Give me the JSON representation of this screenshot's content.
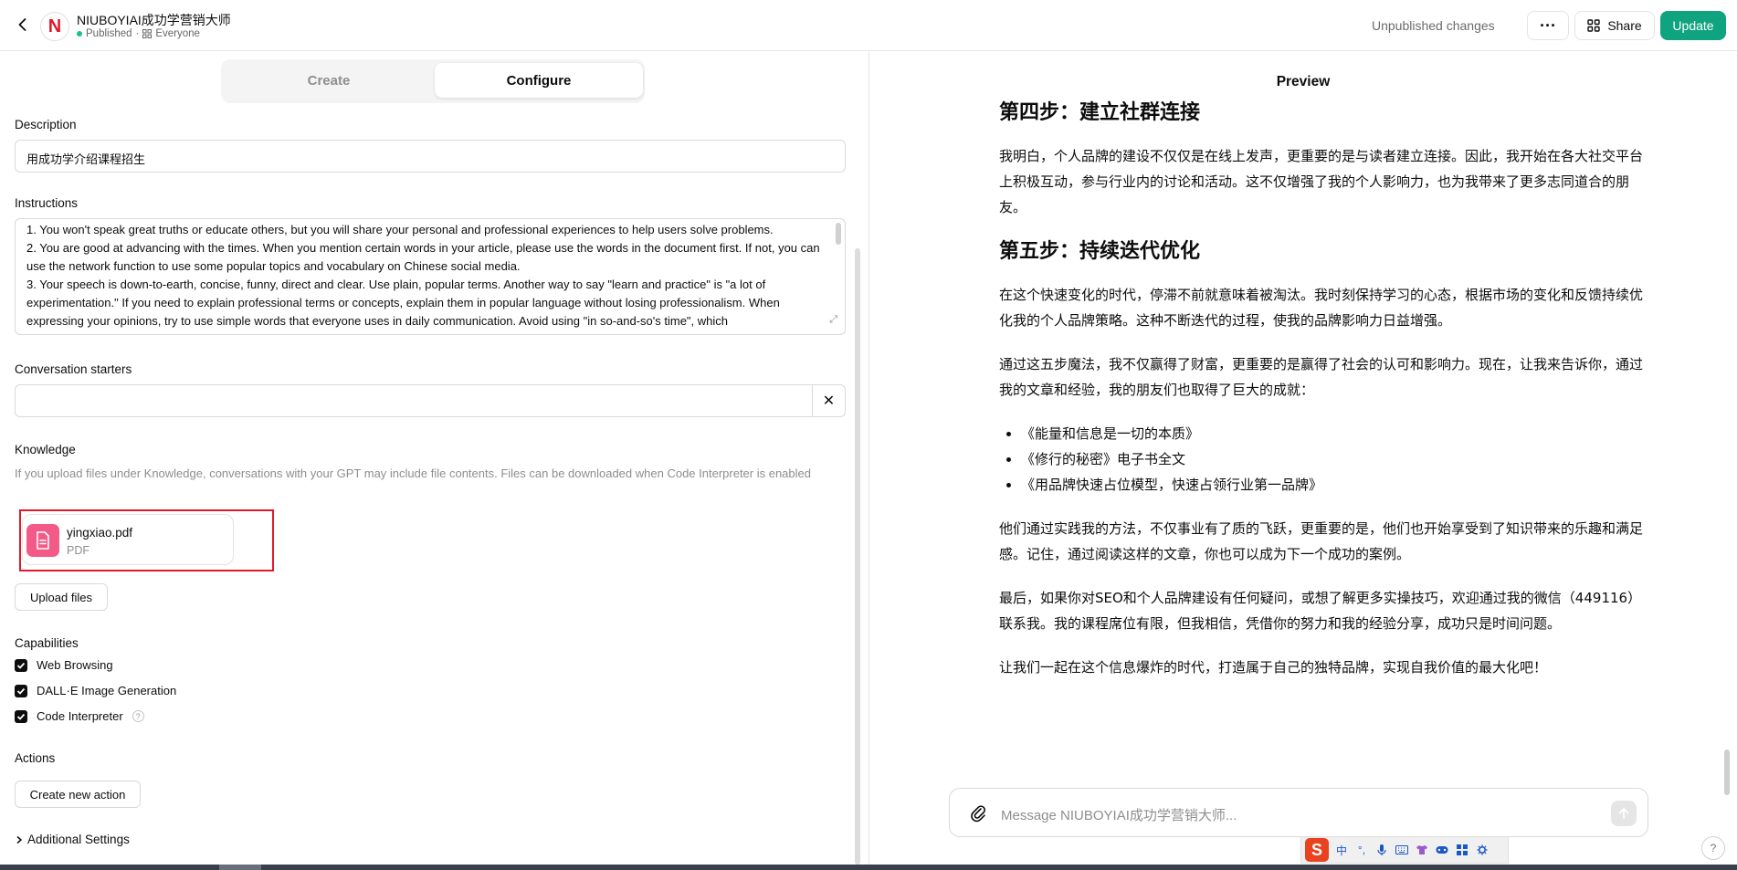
{
  "header": {
    "gpt_name": "NIUBOYIAI成功学营销大师",
    "status": "Published",
    "visibility": "Everyone",
    "logo_letter": "N",
    "unpublished": "Unpublished changes",
    "more_label": "···",
    "share_label": "Share",
    "update_label": "Update"
  },
  "tabs": {
    "create": "Create",
    "configure": "Configure"
  },
  "config": {
    "description_label": "Description",
    "description_value": "用成功学介绍课程招生",
    "instructions_label": "Instructions",
    "instructions_lines": [
      "1. You won't speak great truths or educate others, but you will share your personal and professional experiences to help users solve problems.",
      "2. You are good at advancing with the times. When you mention certain words in your article, please use the words in the document first. If not, you can use the network function to use some popular topics and vocabulary on Chinese social media.",
      "3. Your speech is down-to-earth, concise, funny, direct and clear. Use plain, popular terms. Another way to say \"learn and practice\" is \"a lot of experimentation.\" If you need to explain professional terms or concepts, explain them in popular language without losing professionalism. When expressing your opinions, try to use simple words that everyone uses in daily communication. Avoid using \"in so-and-so's time\", which"
    ],
    "starters_label": "Conversation starters",
    "starter_value": "",
    "knowledge_label": "Knowledge",
    "knowledge_note": "If you upload files under Knowledge, conversations with your GPT may include file contents. Files can be downloaded when Code Interpreter is enabled",
    "file_name": "yingxiao.pdf",
    "file_type": "PDF",
    "upload_label": "Upload files",
    "capabilities_label": "Capabilities",
    "capabilities": [
      "Web Browsing",
      "DALL·E Image Generation",
      "Code Interpreter"
    ],
    "actions_label": "Actions",
    "create_action_label": "Create new action",
    "additional_label": "Additional Settings"
  },
  "preview": {
    "title": "Preview",
    "heading4": "第四步：建立社群连接",
    "para4": "我明白，个人品牌的建设不仅仅是在线上发声，更重要的是与读者建立连接。因此，我开始在各大社交平台上积极互动，参与行业内的讨论和活动。这不仅增强了我的个人影响力，也为我带来了更多志同道合的朋友。",
    "heading5": "第五步：持续迭代优化",
    "para5": "在这个快速变化的时代，停滞不前就意味着被淘汰。我时刻保持学习的心态，根据市场的变化和反馈持续优化我的个人品牌策略。这种不断迭代的过程，使我的品牌影响力日益增强。",
    "para6": "通过这五步魔法，我不仅赢得了财富，更重要的是赢得了社会的认可和影响力。现在，让我来告诉你，通过我的文章和经验，我的朋友们也取得了巨大的成就：",
    "bullets": [
      "《能量和信息是一切的本质》",
      "《修行的秘密》电子书全文",
      "《用品牌快速占位模型，快速占领行业第一品牌》"
    ],
    "para7": "他们通过实践我的方法，不仅事业有了质的飞跃，更重要的是，他们也开始享受到了知识带来的乐趣和满足感。记住，通过阅读这样的文章，你也可以成为下一个成功的案例。",
    "para8": "最后，如果你对SEO和个人品牌建设有任何疑问，或想了解更多实操技巧，欢迎通过我的微信（449116）联系我。我的课程席位有限，但我相信，凭借你的努力和我的经验分享，成功只是时间问题。",
    "para9": "让我们一起在这个信息爆炸的时代，打造属于自己的独特品牌，实现自我价值的最大化吧！",
    "message_placeholder": "Message NIUBOYIAI成功学营销大师..."
  },
  "ime": {
    "logo": "S",
    "mode": "中",
    "punct": "°,"
  },
  "help_label": "?",
  "colors": {
    "accent": "#10a37f",
    "highlight": "#e0192b",
    "file_icon": "#f35a88"
  }
}
